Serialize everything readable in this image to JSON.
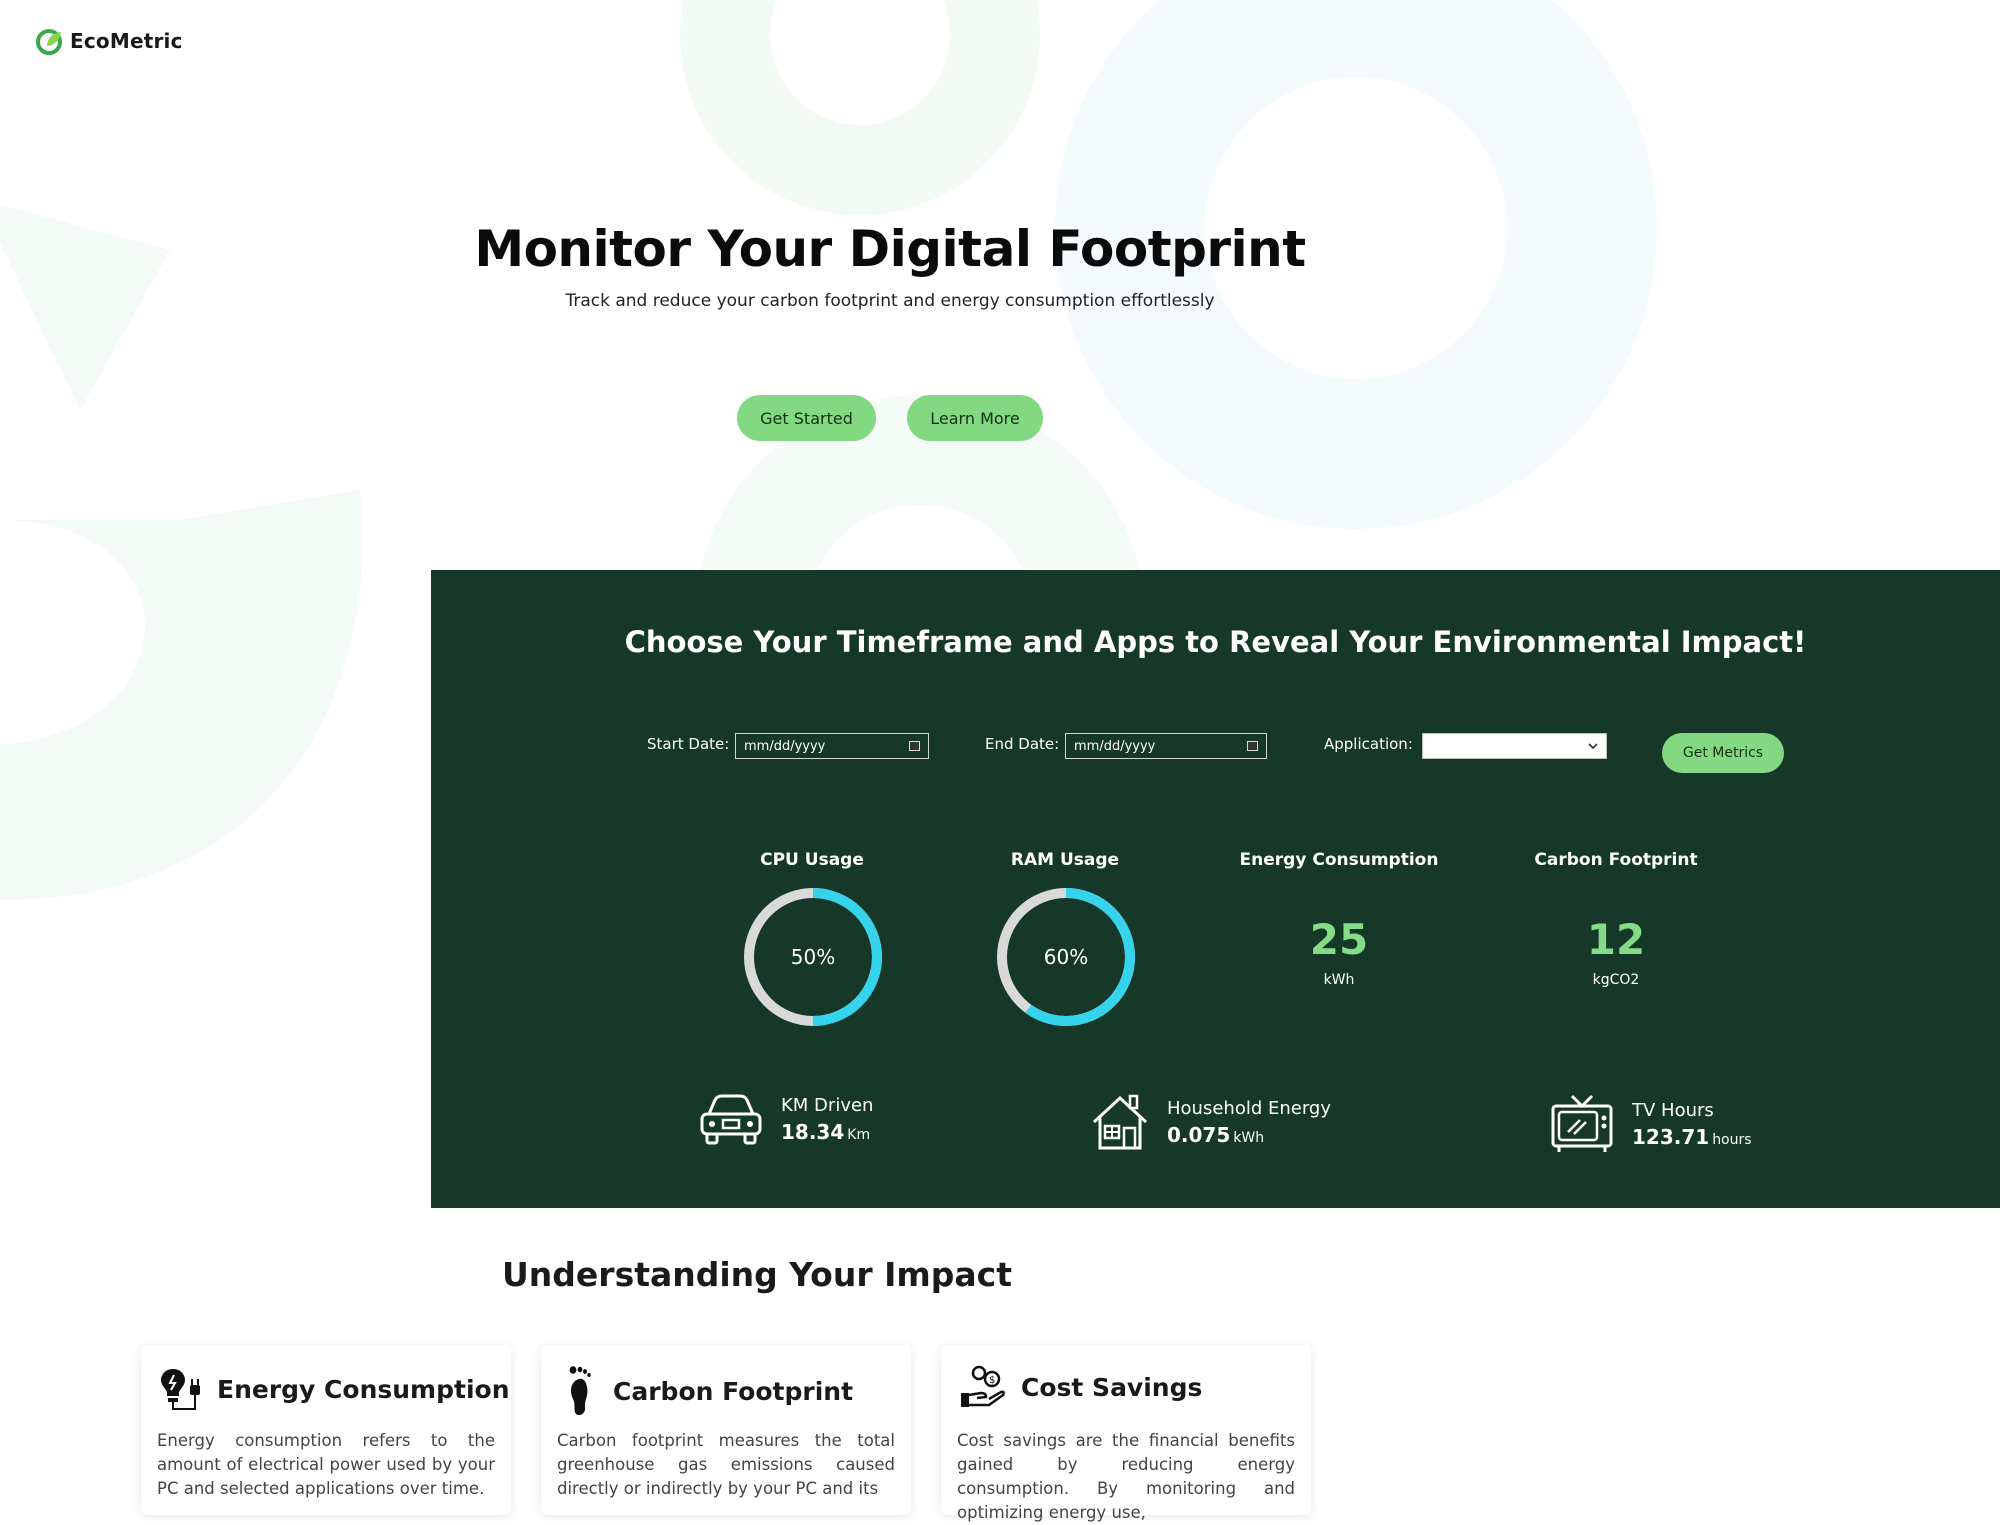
{
  "brand": {
    "name": "EcoMetric"
  },
  "hero": {
    "title": "Monitor Your Digital Footprint",
    "subtitle": "Track and reduce your carbon footprint and energy consumption effortlessly",
    "primary_button": "Get Started",
    "secondary_button": "Learn More"
  },
  "metrics_panel": {
    "title": "Choose Your Timeframe and Apps to Reveal Your Environmental Impact!",
    "start_date_label": "Start Date:",
    "start_date_placeholder": "mm/dd/yyyy",
    "end_date_label": "End Date:",
    "end_date_placeholder": "mm/dd/yyyy",
    "application_label": "Application:",
    "application_value": "",
    "submit_button": "Get Metrics",
    "cpu": {
      "title": "CPU Usage",
      "value": 50,
      "display": "50%"
    },
    "ram": {
      "title": "RAM Usage",
      "value": 60,
      "display": "60%"
    },
    "energy": {
      "title": "Energy Consumption",
      "value": "25",
      "unit": "kWh"
    },
    "carbon": {
      "title": "Carbon Footprint",
      "value": "12",
      "unit": "kgCO2"
    },
    "equivalents": [
      {
        "label": "KM Driven",
        "value": "18.34",
        "unit": "Km",
        "icon": "car-icon"
      },
      {
        "label": "Household Energy",
        "value": "0.075",
        "unit": "kWh",
        "icon": "house-icon"
      },
      {
        "label": "TV Hours",
        "value": "123.71",
        "unit": "hours",
        "icon": "tv-icon"
      }
    ],
    "colors": {
      "background": "#163829",
      "accent": "#86dc86",
      "gauge_fill": "#35d4ec",
      "gauge_track": "#d9d9d9"
    }
  },
  "impact": {
    "title": "Understanding Your Impact",
    "cards": [
      {
        "title": "Energy Consumption",
        "icon": "lightbulb-plug-icon",
        "text": "Energy consumption refers to the amount of electrical power used by your PC and selected applications over time."
      },
      {
        "title": "Carbon Footprint",
        "icon": "footprint-icon",
        "text": "Carbon footprint measures the total greenhouse gas emissions caused directly or indirectly by your PC and its"
      },
      {
        "title": "Cost Savings",
        "icon": "money-hand-icon",
        "text": "Cost savings are the financial benefits gained by reducing energy consumption. By monitoring and optimizing energy use,"
      }
    ]
  }
}
